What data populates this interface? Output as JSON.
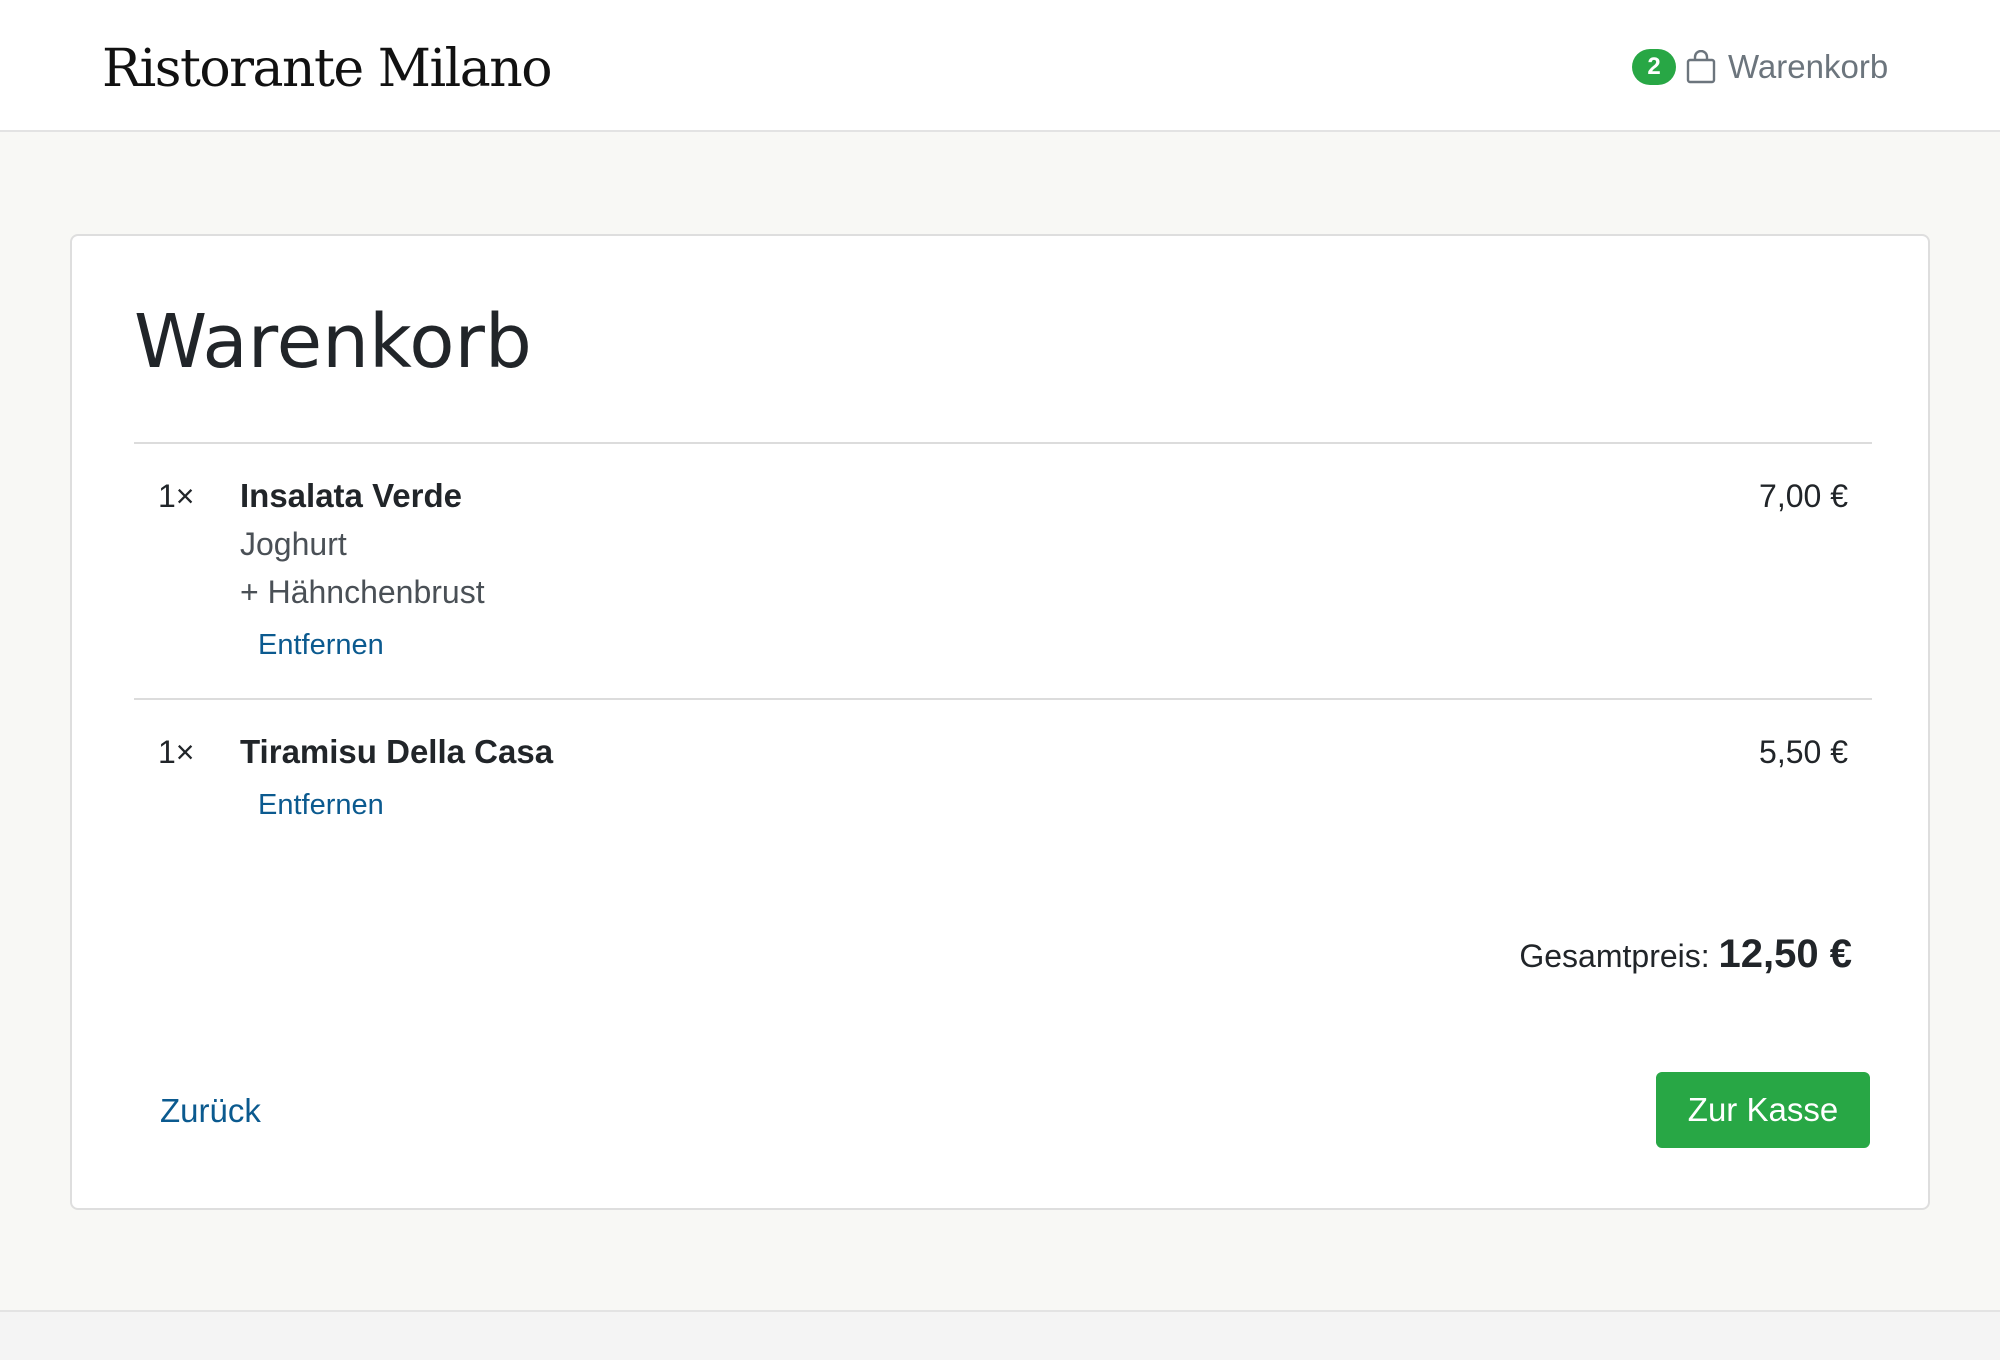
{
  "header": {
    "brand": "Ristorante Milano",
    "cart_count": "2",
    "cart_label": "Warenkorb",
    "cart_icon": "shopping-bag-icon"
  },
  "page": {
    "title": "Warenkorb"
  },
  "cart": {
    "items": [
      {
        "quantity": "1×",
        "name": "Insalata Verde",
        "options": [
          "Joghurt",
          "+ Hähnchenbrust"
        ],
        "price": "7,00 €",
        "remove_label": "Entfernen"
      },
      {
        "quantity": "1×",
        "name": "Tiramisu Della Casa",
        "options": [],
        "price": "5,50 €",
        "remove_label": "Entfernen"
      }
    ],
    "total_label": "Gesamtpreis:",
    "total_value": "12,50 €"
  },
  "actions": {
    "back_label": "Zurück",
    "checkout_label": "Zur Kasse"
  },
  "colors": {
    "accent_green": "#28a745",
    "link_blue": "#0b5a8f"
  }
}
